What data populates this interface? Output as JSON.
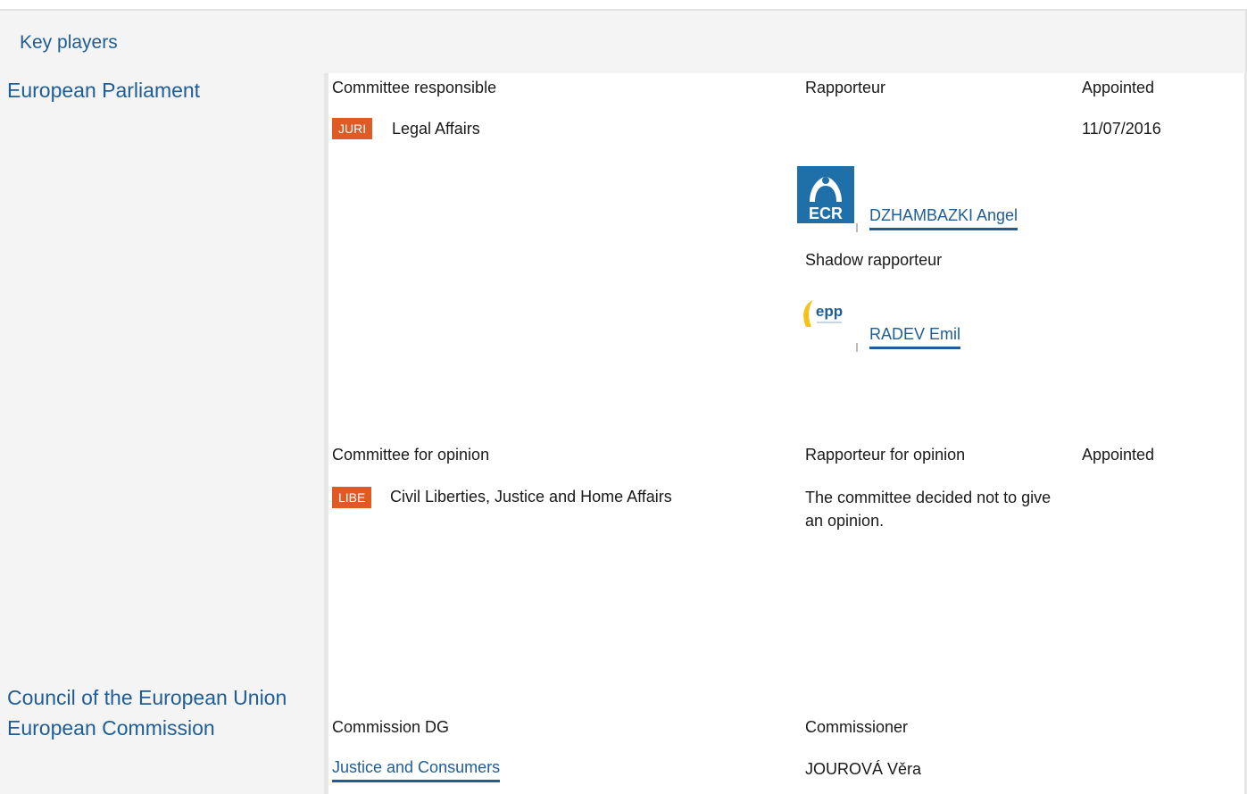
{
  "header": {
    "title": "Key players"
  },
  "institutions": {
    "ep": "European Parliament",
    "council": "Council of the European Union",
    "commission": "European Commission"
  },
  "responsible": {
    "col_committee": "Committee responsible",
    "col_rapporteur": "Rapporteur",
    "col_appointed": "Appointed",
    "committee_code": "JURI",
    "committee_name": "Legal Affairs",
    "appointed_date": "11/07/2016",
    "rapporteur_group": "ECR",
    "rapporteur_name": "DZHAMBAZKI Angel",
    "shadow_label": "Shadow rapporteur",
    "shadow_group": "epp",
    "shadow_name": "RADEV Emil"
  },
  "opinion": {
    "col_committee": "Committee for opinion",
    "col_rapporteur": "Rapporteur for opinion",
    "col_appointed": "Appointed",
    "committee_code": "LIBE",
    "committee_name": "Civil Liberties, Justice and Home Affairs",
    "note": "The committee decided not to give an opinion."
  },
  "commission": {
    "col_dg": "Commission DG",
    "col_commissioner": "Commissioner",
    "dg_name": "Justice and Consumers",
    "commissioner_name": "JOUROVÁ Věra"
  },
  "colors": {
    "link": "#1f5d96",
    "badge": "#e05a26",
    "ecr": "#1f6fa8"
  }
}
